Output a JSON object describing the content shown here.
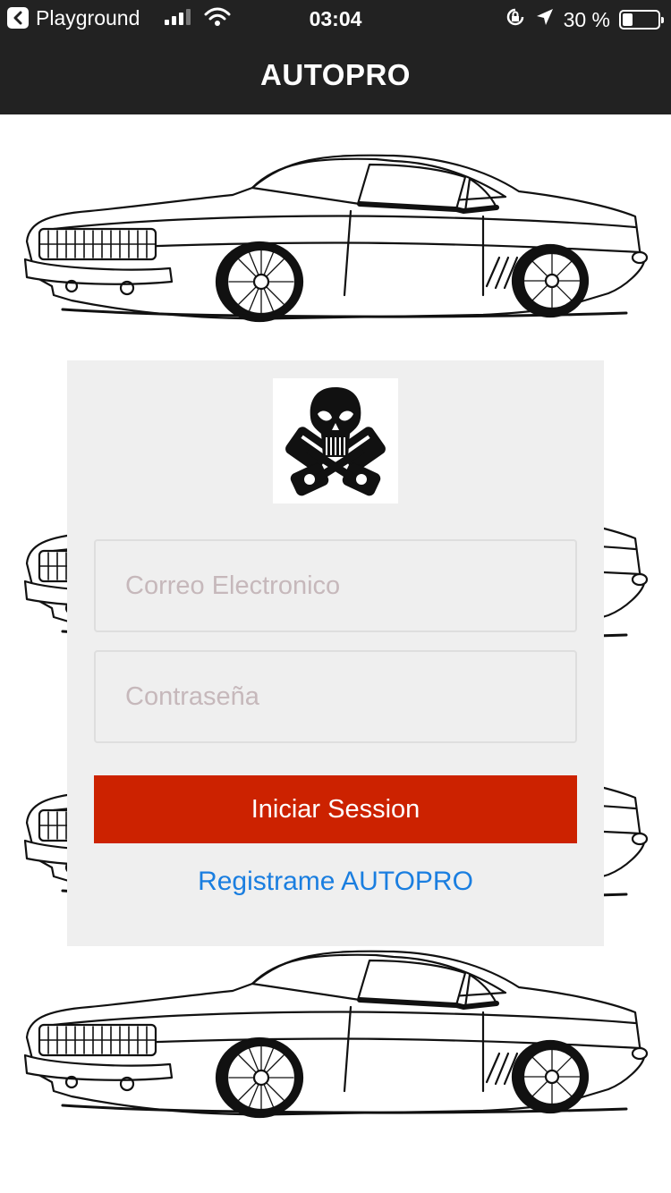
{
  "status_bar": {
    "app_name": "Playground",
    "time": "03:04",
    "battery_percent": "30 %",
    "battery_level": 0.3
  },
  "nav": {
    "title": "AUTOPRO"
  },
  "login": {
    "email_placeholder": "Correo Electronico",
    "password_placeholder": "Contraseña",
    "login_button": "Iniciar Session",
    "register_link": "Registrame AUTOPRO"
  },
  "icons": {
    "back": "chevron-left-icon",
    "signal": "cellular-signal-icon",
    "wifi": "wifi-icon",
    "lock_rotation": "orientation-lock-icon",
    "location": "location-arrow-icon",
    "battery": "battery-icon",
    "logo": "skull-pistons-logo"
  },
  "colors": {
    "nav_background": "#222222",
    "card_background": "#efefef",
    "button": "#cc2200",
    "link": "#1a7ee0",
    "placeholder": "#c6b8bb"
  }
}
